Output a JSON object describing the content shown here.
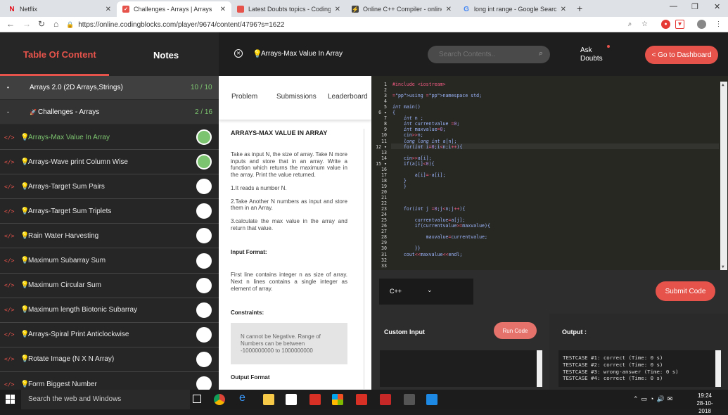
{
  "browser": {
    "tabs": [
      {
        "title": "Netflix",
        "favicon": "N",
        "color": "#e50914"
      },
      {
        "title": "Challenges - Arrays | Arrays",
        "favicon": "✓",
        "color": "#e5534b"
      },
      {
        "title": "Latest Doubts topics - Coding Bl...",
        "favicon": "",
        "color": "#e5534b"
      },
      {
        "title": "Online C++ Compiler - online ed...",
        "favicon": "⚡",
        "color": "#444"
      },
      {
        "title": "long int range - Google Search",
        "favicon": "G",
        "color": "#4285f4"
      }
    ],
    "new_tab": "+",
    "url": "https://online.codingblocks.com/player/9674/content/4796?s=1622"
  },
  "header": {
    "toc_label": "Table Of Content",
    "notes_label": "Notes",
    "lesson_title": "Arrays-Max Value In Array",
    "search_placeholder": "Search Contents..",
    "ask_doubts": "Ask Doubts",
    "dashboard_btn": "< Go to Dashboard"
  },
  "sidebar": {
    "section": {
      "title": "Arrays 2.0 (2D Arrays,Strings)",
      "progress": "10 / 10"
    },
    "subsection": {
      "title": "Challenges - Arrays",
      "progress": "2 / 16"
    },
    "items": [
      {
        "label": "Arrays-Max Value In Array",
        "done": true,
        "active": true
      },
      {
        "label": "Arrays-Wave print Column Wise",
        "done": true,
        "active": false
      },
      {
        "label": "Arrays-Target Sum Pairs",
        "done": false,
        "active": false
      },
      {
        "label": "Arrays-Target Sum Triplets",
        "done": false,
        "active": false
      },
      {
        "label": "Rain Water Harvesting",
        "done": false,
        "active": false
      },
      {
        "label": "Maximum Subarray Sum",
        "done": false,
        "active": false
      },
      {
        "label": "Maximum Circular Sum",
        "done": false,
        "active": false
      },
      {
        "label": "Maximum length Biotonic Subarray",
        "done": false,
        "active": false
      },
      {
        "label": "Arrays-Spiral Print Anticlockwise",
        "done": false,
        "active": false
      },
      {
        "label": "Rotate Image (N X N Array)",
        "done": false,
        "active": false
      },
      {
        "label": "Form Biggest Number",
        "done": false,
        "active": false
      }
    ]
  },
  "problem": {
    "tabs": [
      "Problem",
      "Submissions",
      "Leaderboard"
    ],
    "title": "ARRAYS-MAX VALUE IN ARRAY",
    "description": "Take as input N, the size of array. Take N more inputs and store that in an array. Write a function which returns the maximum value in the array. Print the value returned.",
    "step1": "1.It reads a number N.",
    "step2": "2.Take Another N numbers as input and store them in an Array.",
    "step3": "3.calculate the max value in the array and return that value.",
    "input_format_heading": "Input Format:",
    "input_format": "First line contains integer n as size of array. Next n lines contains a single integer as element of array.",
    "constraints_heading": "Constraints:",
    "constraints": "N cannot be Negative. Range of Numbers can be between -1000000000 to 1000000000",
    "output_format_heading": "Output Format"
  },
  "editor": {
    "lines": [
      "#include <iostream>",
      "",
      "using namespace std;",
      "",
      "int main()",
      "{",
      "    int n ;",
      "    int currentvalue =0;",
      "    int maxvalue=0;",
      "    cin>>n;",
      "    long long int a[n];",
      "    for(int i=0;i<n;i++){",
      "",
      "    cin>>a[i];",
      "    if(a[i]<0){",
      "",
      "        a[i]=-a[i];",
      "    }",
      "    }",
      "",
      "",
      "",
      "    for(int j =0;j<n;j++){",
      "",
      "        currentvalue=a[j];",
      "        if(currentvalue>=maxvalue){",
      "",
      "            maxvalue=currentvalue;",
      "",
      "        }}",
      "    cout<<maxvalue<<endl;",
      "",
      ""
    ]
  },
  "runner": {
    "language": "C++",
    "submit_btn": "Submit Code",
    "custom_input_label": "Custom Input",
    "run_btn": "Run Code",
    "output_label": "Output :",
    "output_lines": [
      "TESTCASE #1: correct (Time: 0 s)",
      "TESTCASE #2: correct (Time: 0 s)",
      "TESTCASE #3: wrong-answer (Time: 0 s)",
      "TESTCASE #4: correct (Time: 0 s)"
    ]
  },
  "taskbar": {
    "search_placeholder": "Search the web and Windows",
    "time": "19:24",
    "date": "28-10-2018"
  }
}
